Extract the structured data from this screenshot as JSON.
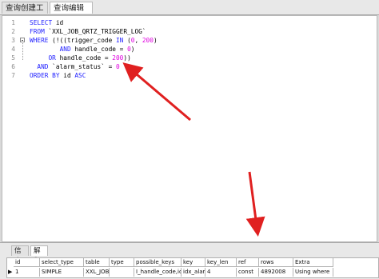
{
  "tabs": [
    {
      "label": "查询创建工具"
    },
    {
      "label": "查询编辑器"
    }
  ],
  "editor": {
    "lines": [
      {
        "num": "1",
        "parts": [
          {
            "t": "SELECT",
            "c": "kw"
          },
          {
            "t": " id",
            "c": "str"
          }
        ]
      },
      {
        "num": "2",
        "parts": [
          {
            "t": "FROM",
            "c": "kw"
          },
          {
            "t": " `XXL_JOB_QRTZ_TRIGGER_LOG`",
            "c": "str"
          }
        ]
      },
      {
        "num": "3",
        "parts": [
          {
            "t": "WHERE",
            "c": "kw"
          },
          {
            "t": " (!((trigger_code ",
            "c": "str"
          },
          {
            "t": "IN",
            "c": "kw"
          },
          {
            "t": " (",
            "c": "str"
          },
          {
            "t": "0",
            "c": "num"
          },
          {
            "t": ", ",
            "c": "str"
          },
          {
            "t": "200",
            "c": "num"
          },
          {
            "t": ")",
            "c": "str"
          }
        ]
      },
      {
        "num": "4",
        "parts": [
          {
            "t": "        ",
            "c": "str"
          },
          {
            "t": "AND",
            "c": "kw"
          },
          {
            "t": " handle_code = ",
            "c": "str"
          },
          {
            "t": "0",
            "c": "num"
          },
          {
            "t": ")",
            "c": "str"
          }
        ]
      },
      {
        "num": "5",
        "parts": [
          {
            "t": "     ",
            "c": "str"
          },
          {
            "t": "OR",
            "c": "kw"
          },
          {
            "t": " handle_code = ",
            "c": "str"
          },
          {
            "t": "200",
            "c": "num"
          },
          {
            "t": "))",
            "c": "str"
          }
        ]
      },
      {
        "num": "6",
        "parts": [
          {
            "t": "  ",
            "c": "str"
          },
          {
            "t": "AND",
            "c": "kw"
          },
          {
            "t": " `alarm_status` = ",
            "c": "str"
          },
          {
            "t": "0",
            "c": "num"
          }
        ]
      },
      {
        "num": "7",
        "parts": [
          {
            "t": "ORDER BY",
            "c": "kw"
          },
          {
            "t": " id ",
            "c": "str"
          },
          {
            "t": "ASC",
            "c": "kw"
          }
        ]
      }
    ]
  },
  "bottom_tabs": [
    {
      "label": "信息"
    },
    {
      "label": "解释"
    }
  ],
  "explain": {
    "headers": [
      "id",
      "select_type",
      "table",
      "type",
      "possible_keys",
      "key",
      "key_len",
      "ref",
      "rows",
      "Extra"
    ],
    "rows": [
      [
        "1",
        "SIMPLE",
        "XXL_JOB_Cref",
        "",
        "I_handle_code,idx",
        "idx_alarm",
        "4",
        "const",
        "4892008",
        "Using where"
      ]
    ],
    "row_marker": "▶"
  },
  "colors": {
    "keyword": "#1e1eff",
    "number": "#e000e0",
    "annotation": "#e02020"
  }
}
